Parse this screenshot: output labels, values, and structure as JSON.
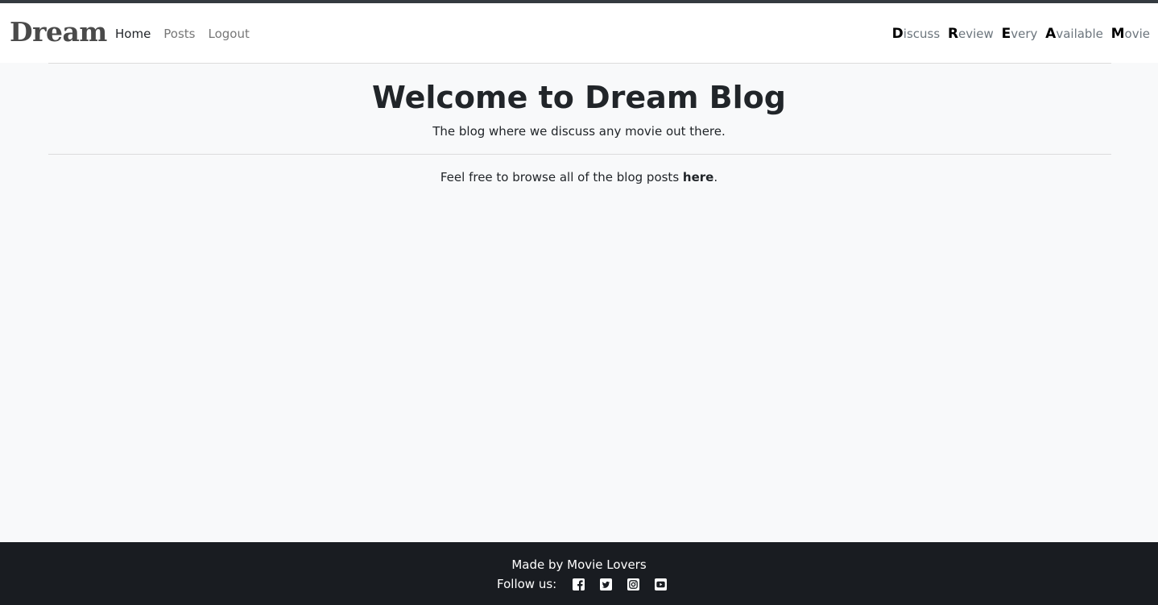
{
  "navbar": {
    "brand": "Dream",
    "links": [
      {
        "label": "Home",
        "active": true
      },
      {
        "label": "Posts",
        "active": false
      },
      {
        "label": "Logout",
        "active": false
      }
    ],
    "tagline": [
      {
        "cap": "D",
        "rest": "iscuss"
      },
      {
        "cap": "R",
        "rest": "eview"
      },
      {
        "cap": "E",
        "rest": "very"
      },
      {
        "cap": "A",
        "rest": "vailable"
      },
      {
        "cap": "M",
        "rest": "ovie"
      }
    ]
  },
  "hero": {
    "title": "Welcome to Dream Blog",
    "subtitle": "The blog where we discuss any movie out there."
  },
  "browse": {
    "prefix": "Feel free to browse all of the blog posts ",
    "link_label": "here",
    "suffix": "."
  },
  "footer": {
    "made_by": "Made by Movie Lovers",
    "follow_label": "Follow us:",
    "social_icons": [
      "facebook-icon",
      "twitter-icon",
      "instagram-icon",
      "youtube-icon"
    ]
  },
  "colors": {
    "page_bg": "#f8f9fa",
    "navbar_bg": "#ffffff",
    "footer_bg": "#191c21",
    "text": "#212529",
    "muted": "#777777"
  }
}
